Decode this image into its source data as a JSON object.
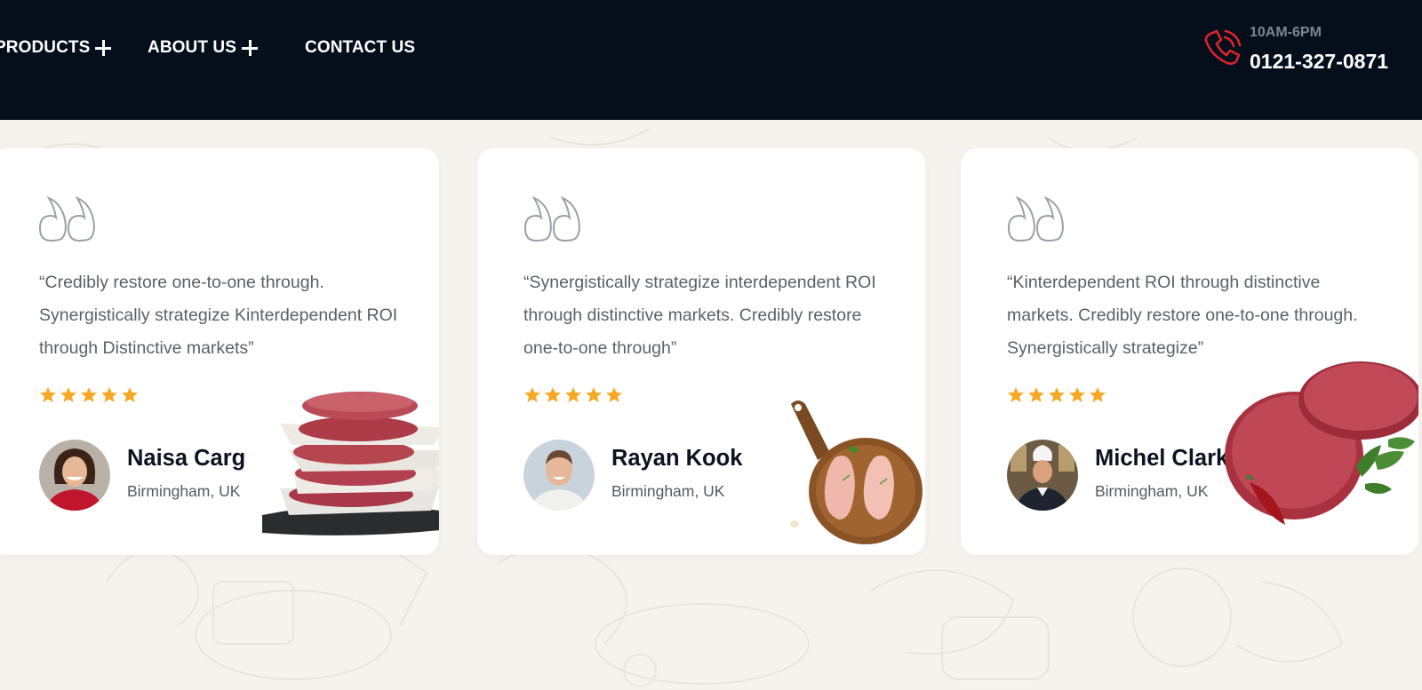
{
  "header": {
    "nav": [
      {
        "label": "PRODUCTS"
      },
      {
        "label": "ABOUT US"
      },
      {
        "label": "CONTACT US"
      }
    ],
    "phone": {
      "hours": "10AM-6PM",
      "number": "0121-327-0871",
      "icon": "phone-icon",
      "accent_color": "#e0232a"
    },
    "background_color": "#050f1c"
  },
  "testimonials": [
    {
      "quote": "“Credibly restore one-to-one through. Synergistically strategize Kinterdependent ROI through Distinctive markets”",
      "rating": 5,
      "name": "Naisa Carg",
      "location": "Birmingham, UK",
      "avatar": "woman-portrait-avatar",
      "image": "stacked-burger-patties-image"
    },
    {
      "quote": "“Synergistically strategize interdependent ROI through distinctive markets. Credibly restore one-to-one through”",
      "rating": 5,
      "name": "Rayan Kook",
      "location": "Birmingham, UK",
      "avatar": "man-portrait-avatar",
      "image": "chicken-breast-board-image"
    },
    {
      "quote": "“Kinterdependent ROI through distinctive markets. Credibly restore one-to-one through. Synergistically strategize”",
      "rating": 5,
      "name": "Michel Clark",
      "location": "Birmingham, UK",
      "avatar": "chef-portrait-avatar",
      "image": "beef-patties-chili-image"
    }
  ],
  "colors": {
    "star": "#f7a823",
    "page_background": "#f6f3ee",
    "card_background": "#ffffff"
  }
}
